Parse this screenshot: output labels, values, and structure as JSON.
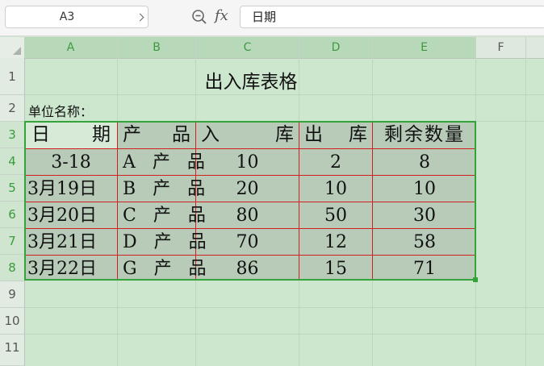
{
  "formula_bar": {
    "cell_ref": "A3",
    "fx_label": "fx",
    "content": "日期",
    "zoom_icon": "zoom-icon",
    "dropdown_icon": "chevron-down-icon"
  },
  "columns": [
    "A",
    "B",
    "C",
    "D",
    "E",
    "F"
  ],
  "rows": [
    "1",
    "2",
    "3",
    "4",
    "5",
    "6",
    "7",
    "8",
    "9",
    "10",
    "11"
  ],
  "sheet": {
    "title": "出入库表格",
    "unit_label": "单位名称：",
    "table": {
      "headers": [
        {
          "chars": [
            "日",
            "期"
          ]
        },
        {
          "chars": [
            "产",
            "品"
          ]
        },
        {
          "chars": [
            "入",
            "库"
          ]
        },
        {
          "chars": [
            "出",
            "库"
          ]
        },
        {
          "chars": [
            "剩余数量"
          ]
        }
      ],
      "rows": [
        [
          "3-18",
          "A 产 品",
          "10",
          "2",
          "8"
        ],
        [
          "3月19日",
          "B 产 品",
          "20",
          "10",
          "10"
        ],
        [
          "3月20日",
          "C 产 品",
          "80",
          "50",
          "30"
        ],
        [
          "3月21日",
          "D 产 品",
          "70",
          "12",
          "58"
        ],
        [
          "3月22日",
          "G 产 品",
          "86",
          "15",
          "71"
        ]
      ]
    }
  },
  "colors": {
    "sheet_background": "#cde7cf",
    "table_fill": "#b7cbb8",
    "table_border": "#d02020",
    "selection": "#35a23a",
    "column_header_text": "#3c9a3f"
  }
}
